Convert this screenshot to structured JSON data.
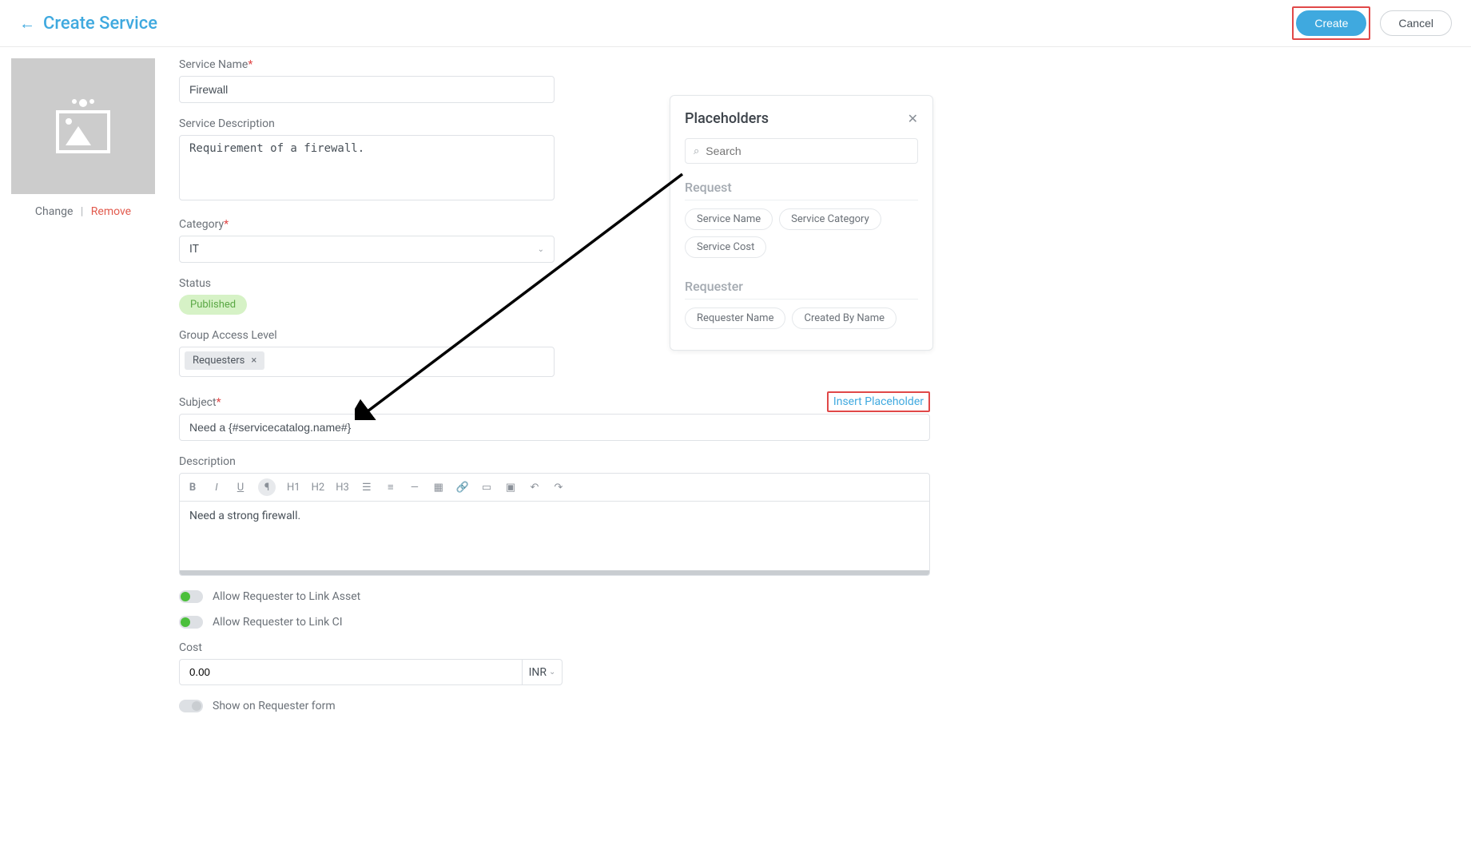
{
  "header": {
    "title": "Create Service",
    "create_btn": "Create",
    "cancel_btn": "Cancel"
  },
  "image_actions": {
    "change": "Change",
    "remove": "Remove"
  },
  "form": {
    "service_name_label": "Service Name",
    "service_name_value": "Firewall",
    "service_desc_label": "Service Description",
    "service_desc_value": "Requirement of a firewall.",
    "category_label": "Category",
    "category_value": "IT",
    "status_label": "Status",
    "status_value": "Published",
    "group_label": "Group Access Level",
    "group_tag": "Requesters",
    "subject_label": "Subject",
    "subject_value": "Need a {#servicecatalog.name#}",
    "insert_placeholder_link": "Insert Placeholder",
    "description_label": "Description",
    "description_value": "Need a strong firewall.",
    "allow_asset_label": "Allow Requester to Link Asset",
    "allow_ci_label": "Allow Requester to Link CI",
    "cost_label": "Cost",
    "cost_value": "0.00",
    "cost_currency": "INR",
    "show_on_form_label": "Show on Requester form"
  },
  "toolbar": {
    "b": "B",
    "i": "I",
    "u": "U",
    "para": "¶",
    "h1": "H1",
    "h2": "H2",
    "h3": "H3"
  },
  "popover": {
    "title": "Placeholders",
    "search_placeholder": "Search",
    "section_request": "Request",
    "chips_request": [
      "Service Name",
      "Service Category",
      "Service Cost"
    ],
    "section_requester": "Requester",
    "chips_requester": [
      "Requester Name",
      "Created By Name"
    ]
  }
}
